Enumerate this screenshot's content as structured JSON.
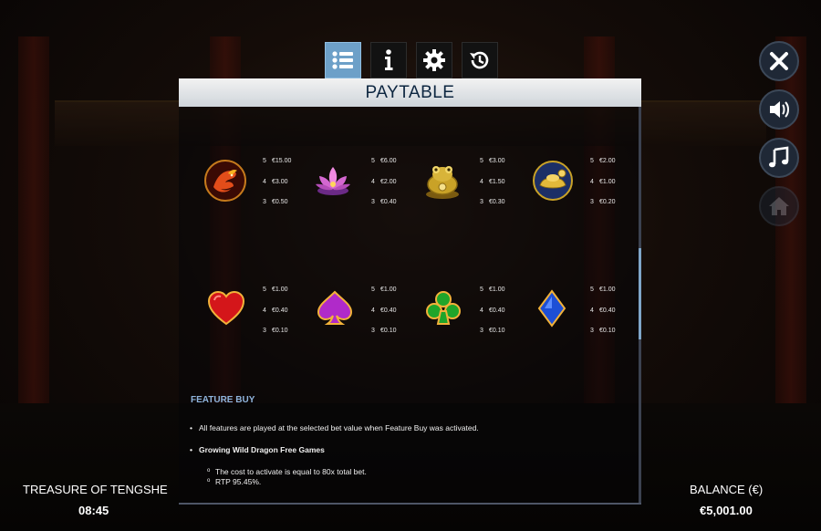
{
  "tabs": [
    {
      "icon": "list-icon",
      "active": true
    },
    {
      "icon": "info-icon",
      "active": false
    },
    {
      "icon": "gear-icon",
      "active": false
    },
    {
      "icon": "history-icon",
      "active": false
    }
  ],
  "header": {
    "title": "PAYTABLE"
  },
  "symbols": [
    {
      "icon": "dragon-icon",
      "pays": [
        {
          "n": "5",
          "v": "€15.00"
        },
        {
          "n": "4",
          "v": "€3.00"
        },
        {
          "n": "3",
          "v": "€0.50"
        }
      ]
    },
    {
      "icon": "lotus-icon",
      "pays": [
        {
          "n": "5",
          "v": "€6.00"
        },
        {
          "n": "4",
          "v": "€2.00"
        },
        {
          "n": "3",
          "v": "€0.40"
        }
      ]
    },
    {
      "icon": "frog-icon",
      "pays": [
        {
          "n": "5",
          "v": "€3.00"
        },
        {
          "n": "4",
          "v": "€1.50"
        },
        {
          "n": "3",
          "v": "€0.30"
        }
      ]
    },
    {
      "icon": "gold-ingot-icon",
      "pays": [
        {
          "n": "5",
          "v": "€2.00"
        },
        {
          "n": "4",
          "v": "€1.00"
        },
        {
          "n": "3",
          "v": "€0.20"
        }
      ]
    },
    {
      "icon": "heart-icon",
      "pays": [
        {
          "n": "5",
          "v": "€1.00"
        },
        {
          "n": "4",
          "v": "€0.40"
        },
        {
          "n": "3",
          "v": "€0.10"
        }
      ]
    },
    {
      "icon": "spade-icon",
      "pays": [
        {
          "n": "5",
          "v": "€1.00"
        },
        {
          "n": "4",
          "v": "€0.40"
        },
        {
          "n": "3",
          "v": "€0.10"
        }
      ]
    },
    {
      "icon": "club-icon",
      "pays": [
        {
          "n": "5",
          "v": "€1.00"
        },
        {
          "n": "4",
          "v": "€0.40"
        },
        {
          "n": "3",
          "v": "€0.10"
        }
      ]
    },
    {
      "icon": "diamond-icon",
      "pays": [
        {
          "n": "5",
          "v": "€1.00"
        },
        {
          "n": "4",
          "v": "€0.40"
        },
        {
          "n": "3",
          "v": "€0.10"
        }
      ]
    }
  ],
  "feature_buy": {
    "title": "FEATURE BUY",
    "line1": "All features are played at the selected bet value when Feature Buy was activated.",
    "line2": "Growing Wild Dragon Free Games",
    "sub1": "The cost to activate is equal to 80x total bet.",
    "sub2": "RTP 95.45%."
  },
  "side_buttons": [
    {
      "icon": "close-icon"
    },
    {
      "icon": "sound-icon"
    },
    {
      "icon": "music-icon"
    },
    {
      "icon": "home-icon",
      "disabled": true
    }
  ],
  "footer": {
    "game_title": "TREASURE OF TENGSHE",
    "time": "08:45",
    "balance_label": "BALANCE (€)",
    "balance_value": "€5,001.00"
  },
  "colors": {
    "accent": "#6da0c8",
    "feature_title": "#8fb4dc",
    "header_text": "#0d2640"
  }
}
